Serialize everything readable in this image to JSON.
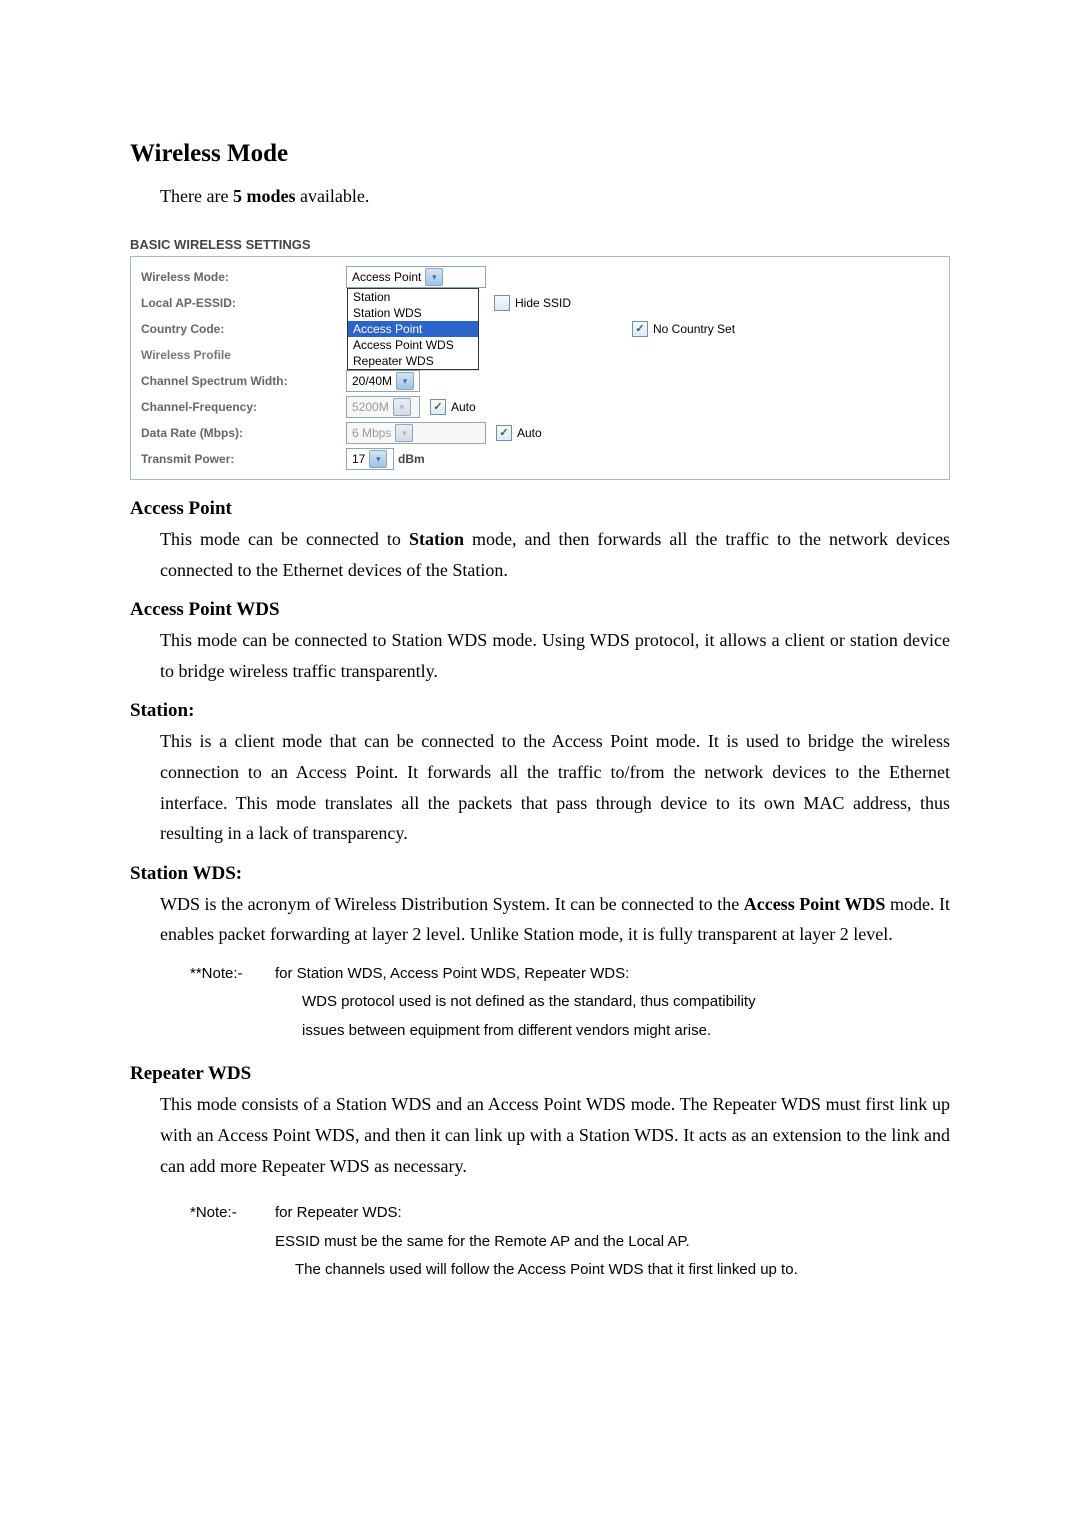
{
  "title": "Wireless Mode",
  "intro_prefix": "There are ",
  "intro_bold": "5 modes",
  "intro_suffix": " available.",
  "panel": {
    "heading": "BASIC WIRELESS SETTINGS",
    "labels": {
      "wireless_mode": "Wireless Mode:",
      "local_ap_essid": "Local AP-ESSID:",
      "country_code": "Country Code:",
      "wireless_profile": "Wireless Profile",
      "channel_spectrum": "Channel Spectrum Width:",
      "channel_frequency": "Channel-Frequency:",
      "data_rate": "Data Rate (Mbps):",
      "transmit_power": "Transmit Power:"
    },
    "values": {
      "wireless_mode": "Access Point",
      "channel_spectrum": "20/40M",
      "channel_frequency": "5200M",
      "data_rate": "6 Mbps",
      "transmit_power": "17"
    },
    "checks": {
      "hide_ssid": "Hide SSID",
      "no_country_set": "No Country Set",
      "auto_freq": "Auto",
      "auto_rate": "Auto"
    },
    "dropdown_options": [
      "Station",
      "Station WDS",
      "Access Point",
      "Access Point WDS",
      "Repeater WDS"
    ],
    "transmit_unit": "dBm"
  },
  "sections": {
    "ap": {
      "heading": "Access Point",
      "text": "This mode can be connected to Station mode, and then forwards all the traffic to the network devices connected to the Ethernet devices of the Station.",
      "bold_word": "Station"
    },
    "apwds": {
      "heading": "Access Point WDS",
      "text": "This mode can be connected to Station WDS mode. Using WDS protocol, it allows a client or station device to bridge wireless traffic transparently."
    },
    "station": {
      "heading": "Station:",
      "text": "This is a client mode that can be connected to the Access Point mode. It is used to bridge the wireless connection to an Access Point. It forwards all the traffic to/from the network devices to the Ethernet interface. This mode translates all the packets that pass through device to its own MAC address, thus resulting in a lack of transparency."
    },
    "stationwds": {
      "heading": "Station WDS:",
      "pre": "WDS is the acronym of Wireless Distribution System. It can be connected to the ",
      "bold1": "Access Point WDS",
      "post": " mode. It enables packet forwarding at layer 2 level. Unlike Station mode, it is fully transparent at layer 2 level."
    },
    "note1": {
      "tag": "**Note:-",
      "l1": "for Station WDS, Access Point WDS, Repeater WDS:",
      "l2": "WDS protocol used is not defined as the standard, thus compatibility",
      "l3": "issues between equipment from different vendors might arise."
    },
    "repeater": {
      "heading": "Repeater WDS",
      "text": "This mode consists of a Station WDS and an Access Point WDS mode. The Repeater WDS must first link up with an Access Point WDS, and then it can link up with a Station WDS. It acts as an extension to the link and can add more Repeater WDS as necessary."
    },
    "note2": {
      "tag": "*Note:-",
      "l1": "for Repeater WDS:",
      "l2": "ESSID must be the same for the Remote AP and the Local AP.",
      "l3": "The channels used will follow the Access Point WDS that it first linked up to."
    }
  }
}
